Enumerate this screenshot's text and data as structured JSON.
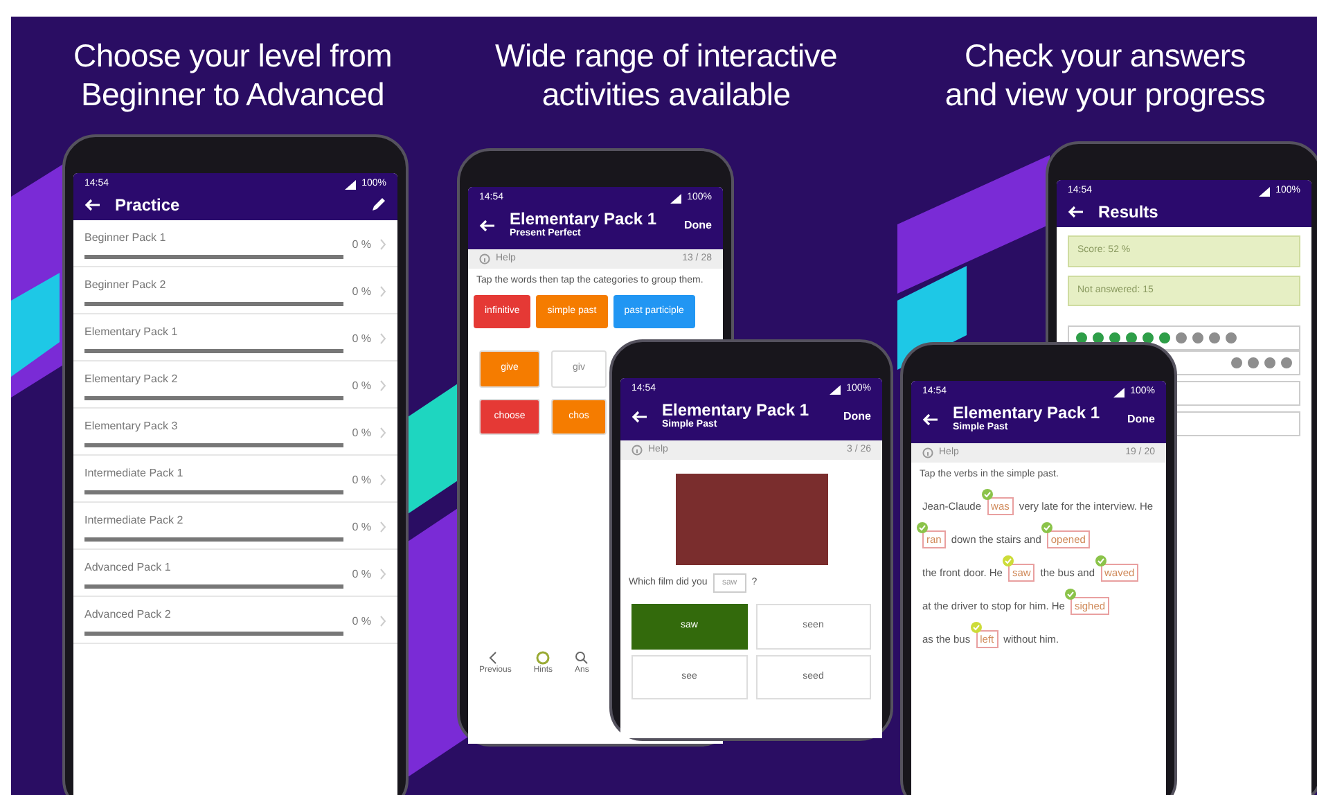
{
  "captions": [
    "Choose your level from\nBeginner to Advanced",
    "Wide range of interactive\nactivities available",
    "Check your answers\nand view your progress"
  ],
  "phones": [
    {
      "kind": "practice",
      "time": "14:54",
      "battery": "100%",
      "title": "Practice",
      "packs": [
        {
          "name": "Beginner Pack 1",
          "percent": "0 %",
          "level": 0
        },
        {
          "name": "Beginner Pack 2",
          "percent": "0 %",
          "level": 0
        },
        {
          "name": "Elementary Pack 1",
          "percent": "0 %",
          "level": 0
        },
        {
          "name": "Elementary Pack 2",
          "percent": "0 %",
          "level": 0
        },
        {
          "name": "Elementary Pack 3",
          "percent": "0 %",
          "level": 0
        },
        {
          "name": "Intermediate Pack 1",
          "percent": "0 %",
          "level": 0
        },
        {
          "name": "Intermediate Pack 2",
          "percent": "0 %",
          "level": 0
        },
        {
          "name": "Advanced Pack 1",
          "percent": "0 %",
          "level": 0
        },
        {
          "name": "Advanced Pack 2",
          "percent": "0 %",
          "level": 0
        }
      ]
    },
    {
      "kind": "sort",
      "time": "14:54",
      "battery": "100%",
      "title": "Elementary Pack 1",
      "subtitle": "Present Perfect",
      "action": "Done",
      "help": "Help",
      "counter": "13 / 28",
      "instruction": "Tap the words then tap the categories to group them.",
      "categories": [
        {
          "label": "infinitive",
          "color": "#e53935"
        },
        {
          "label": "simple past",
          "color": "#f57c00"
        },
        {
          "label": "past participle",
          "color": "#2196f3"
        }
      ],
      "words": [
        {
          "label": "give",
          "color": "#f57c00"
        },
        {
          "label": "giv",
          "color": "#ffffff"
        },
        {
          "label": "choose",
          "color": "#e53935"
        },
        {
          "label": "chos",
          "color": "#f57c00"
        }
      ],
      "nav": [
        "Previous",
        "Hints",
        "Ans"
      ]
    },
    {
      "kind": "quiz",
      "time": "14:54",
      "battery": "100%",
      "title": "Elementary Pack 1",
      "subtitle": "Simple Past",
      "action": "Done",
      "help": "Help",
      "counter": "3 / 26",
      "question": "Which film did you",
      "answer": "saw",
      "question_end": "?",
      "options": [
        {
          "label": "saw",
          "selected": true
        },
        {
          "label": "seen",
          "selected": false
        },
        {
          "label": "see",
          "selected": false
        },
        {
          "label": "seed",
          "selected": false
        }
      ]
    },
    {
      "kind": "results",
      "time": "14:54",
      "battery": "100%",
      "title": "Results",
      "score": "Score: 52 %",
      "unanswered": "Not answered: 15",
      "answer_rows": [
        [
          {
            "correct": true
          },
          {
            "correct": true
          },
          {
            "correct": true
          },
          {
            "correct": true
          },
          {
            "correct": true
          },
          {
            "correct": true
          },
          {
            "correct": false
          },
          {
            "correct": false
          },
          {
            "correct": false
          },
          {
            "correct": false
          }
        ],
        [
          {
            "correct": false
          },
          {
            "correct": false
          },
          {
            "correct": false
          },
          {
            "correct": false
          }
        ]
      ]
    },
    {
      "kind": "passage",
      "time": "14:54",
      "battery": "100%",
      "title": "Elementary Pack 1",
      "subtitle": "Simple Past",
      "action": "Done",
      "help": "Help",
      "counter": "19 / 20",
      "instruction": "Tap the verbs in the simple past.",
      "passage": [
        {
          "kind": "text",
          "text": "Jean-Claude"
        },
        {
          "kind": "verb",
          "text": "was",
          "color": "#8bc34a"
        },
        {
          "kind": "text",
          "text": "very late for the interview. He"
        },
        {
          "kind": "verb",
          "text": "ran",
          "color": "#8bc34a"
        },
        {
          "kind": "text",
          "text": "down the stairs and"
        },
        {
          "kind": "verb",
          "text": "opened",
          "color": "#8bc34a"
        },
        {
          "kind": "text",
          "text": "the front door. He"
        },
        {
          "kind": "verb",
          "text": "saw",
          "color": "#cddc39"
        },
        {
          "kind": "text",
          "text": "the bus and"
        },
        {
          "kind": "verb",
          "text": "waved",
          "color": "#8bc34a"
        },
        {
          "kind": "text",
          "text": "at the driver to stop for him. He"
        },
        {
          "kind": "verb",
          "text": "sighed",
          "color": "#8bc34a"
        },
        {
          "kind": "text",
          "text": "as the bus"
        },
        {
          "kind": "verb",
          "text": "left",
          "color": "#cddc39"
        },
        {
          "kind": "text",
          "text": "without him."
        }
      ]
    }
  ]
}
